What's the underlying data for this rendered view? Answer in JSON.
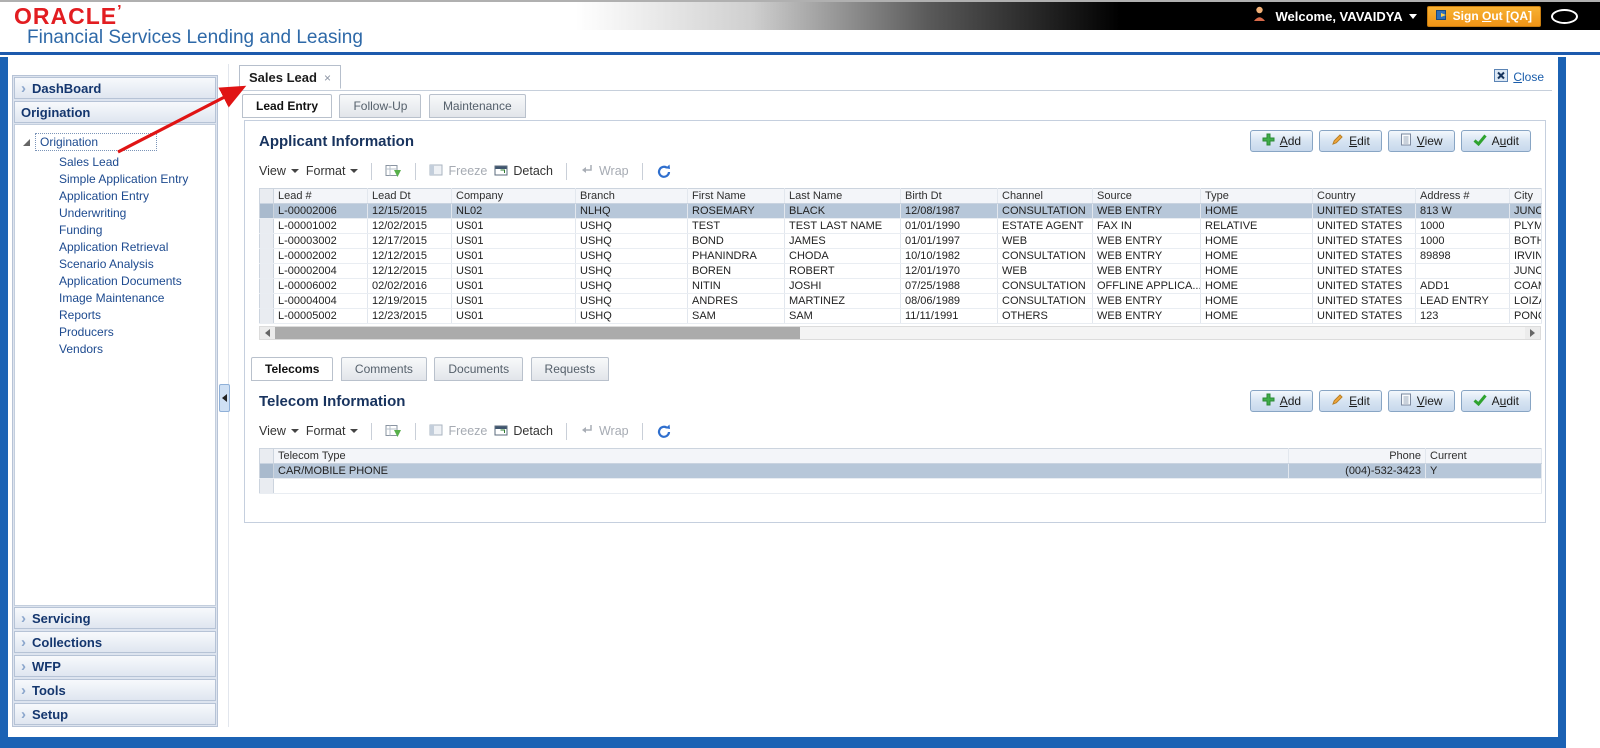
{
  "header": {
    "logo": "ORACLE",
    "tagline": "Financial Services Lending and Leasing",
    "welcome": "Welcome, VAVAIDYA",
    "sign_out": {
      "label": "Sign Out [QA]",
      "key": "O"
    }
  },
  "sidebar": {
    "dashboard": "DashBoard",
    "origination_header": "Origination",
    "tree_root": "Origination",
    "tree_items": [
      "Sales Lead",
      "Simple Application Entry",
      "Application Entry",
      "Underwriting",
      "Funding",
      "Application Retrieval",
      "Scenario Analysis",
      "Application Documents",
      "Image Maintenance",
      "Reports",
      "Producers",
      "Vendors"
    ],
    "sections": [
      "Servicing",
      "Collections",
      "WFP",
      "Tools",
      "Setup"
    ]
  },
  "main": {
    "doc_tab": "Sales Lead",
    "close": {
      "label": "Close",
      "key": "C"
    },
    "tabs": [
      "Lead Entry",
      "Follow-Up",
      "Maintenance"
    ],
    "action_buttons": [
      {
        "label": "Add",
        "key": "A"
      },
      {
        "label": "Edit",
        "key": "E"
      },
      {
        "label": "View",
        "key": "V"
      },
      {
        "label": "Audit",
        "key": "u"
      }
    ],
    "toolbar": {
      "view": "View",
      "format": "Format",
      "freeze": "Freeze",
      "detach": "Detach",
      "wrap": "Wrap"
    },
    "applicant": {
      "title": "Applicant Information",
      "columns": [
        "Lead #",
        "Lead Dt",
        "Company",
        "Branch",
        "First Name",
        "Last Name",
        "Birth Dt",
        "Channel",
        "Source",
        "Type",
        "Country",
        "Address #",
        "City"
      ],
      "selected_row": 0,
      "rows": [
        [
          "L-00002006",
          "12/15/2015",
          "NL02",
          "NLHQ",
          "ROSEMARY",
          "BLACK",
          "12/08/1987",
          "CONSULTATION",
          "WEB ENTRY",
          "HOME",
          "UNITED STATES",
          "813 W",
          "JUNCOS"
        ],
        [
          "L-00001002",
          "12/02/2015",
          "US01",
          "USHQ",
          "TEST",
          "TEST LAST NAME",
          "01/01/1990",
          "ESTATE AGENT",
          "FAX IN",
          "RELATIVE",
          "UNITED STATES",
          "1000",
          "PLYMOU"
        ],
        [
          "L-00003002",
          "12/17/2015",
          "US01",
          "USHQ",
          "BOND",
          "JAMES",
          "01/01/1997",
          "WEB",
          "WEB ENTRY",
          "HOME",
          "UNITED STATES",
          "1000",
          "BOTHELL"
        ],
        [
          "L-00002002",
          "12/12/2015",
          "US01",
          "USHQ",
          "PHANINDRA",
          "CHODA",
          "10/10/1982",
          "CONSULTATION",
          "WEB ENTRY",
          "HOME",
          "UNITED STATES",
          "89898",
          "IRVINE"
        ],
        [
          "L-00002004",
          "12/12/2015",
          "US01",
          "USHQ",
          "BOREN",
          "ROBERT",
          "12/01/1970",
          "WEB",
          "WEB ENTRY",
          "HOME",
          "UNITED STATES",
          "",
          "JUNCOS"
        ],
        [
          "L-00006002",
          "02/02/2016",
          "US01",
          "USHQ",
          "NITIN",
          "JOSHI",
          "07/25/1988",
          "CONSULTATION",
          "OFFLINE APPLICA...",
          "HOME",
          "UNITED STATES",
          "ADD1",
          "COAMO"
        ],
        [
          "L-00004004",
          "12/19/2015",
          "US01",
          "USHQ",
          "ANDRES",
          "MARTINEZ",
          "08/06/1989",
          "CONSULTATION",
          "WEB ENTRY",
          "HOME",
          "UNITED STATES",
          "LEAD ENTRY",
          "LOIZA"
        ],
        [
          "L-00005002",
          "12/23/2015",
          "US01",
          "USHQ",
          "SAM",
          "SAM",
          "11/11/1991",
          "OTHERS",
          "WEB ENTRY",
          "HOME",
          "UNITED STATES",
          "123",
          "PONCE"
        ]
      ]
    },
    "subtabs": [
      "Telecoms",
      "Comments",
      "Documents",
      "Requests"
    ],
    "telecom": {
      "title": "Telecom Information",
      "columns": [
        "Telecom Type",
        "Phone",
        "Current"
      ],
      "selected_row": 0,
      "rows": [
        [
          "CAR/MOBILE PHONE",
          "(004)-532-3423",
          "Y"
        ]
      ]
    }
  }
}
